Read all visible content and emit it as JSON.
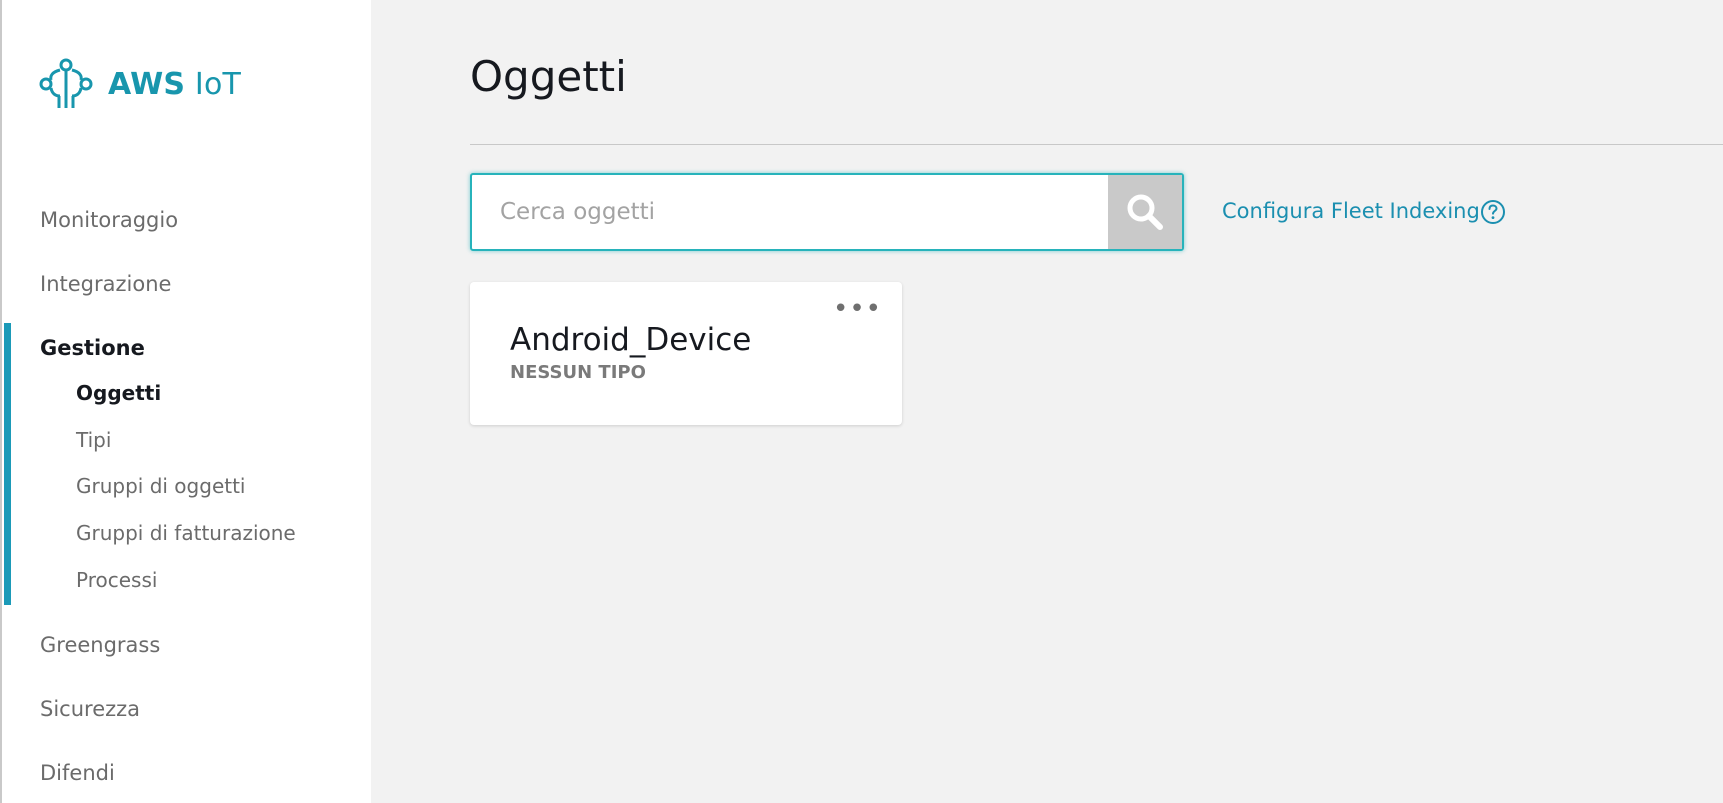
{
  "brand": {
    "name_bold": "AWS",
    "name_light": "IoT",
    "color": "#1896ad"
  },
  "sidebar": {
    "items": [
      {
        "label": "Monitoraggio"
      },
      {
        "label": "Integrazione"
      },
      {
        "label": "Gestione",
        "active": true
      },
      {
        "label": "Greengrass"
      },
      {
        "label": "Sicurezza"
      },
      {
        "label": "Difendi"
      }
    ],
    "sub_items": [
      {
        "label": "Oggetti",
        "active": true
      },
      {
        "label": "Tipi"
      },
      {
        "label": "Gruppi di oggetti"
      },
      {
        "label": "Gruppi di fatturazione"
      },
      {
        "label": "Processi"
      }
    ],
    "accent_color": "#1b9ab8"
  },
  "main": {
    "title": "Oggetti",
    "search": {
      "placeholder": "Cerca oggetti",
      "value": ""
    },
    "fleet_link": "Configura Fleet Indexing",
    "things": [
      {
        "name": "Android_Device",
        "type": "NESSUN TIPO"
      }
    ]
  }
}
